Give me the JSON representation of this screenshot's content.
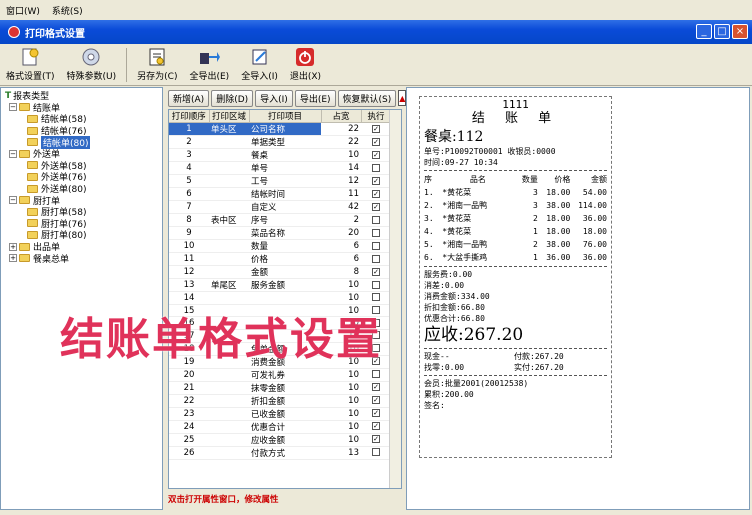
{
  "menu": {
    "items": [
      "窗口(W)",
      "系统(S)"
    ]
  },
  "window": {
    "title": "打印格式设置"
  },
  "toolbar": {
    "buttons": [
      {
        "label": "格式设置(T)",
        "icon": "gear-doc-icon"
      },
      {
        "label": "特殊参数(U)",
        "icon": "cd-icon"
      },
      {
        "label": "另存为(C)",
        "icon": "save-as-icon"
      },
      {
        "label": "全导出(E)",
        "icon": "export-icon"
      },
      {
        "label": "全导入(I)",
        "icon": "import-icon"
      },
      {
        "label": "退出(X)",
        "icon": "power-icon"
      }
    ]
  },
  "tree": {
    "root": "报表类型",
    "groups": [
      {
        "label": "结账单",
        "children": [
          "结帐单(58)",
          "结帐单(76)",
          "结帐单(80)"
        ]
      },
      {
        "label": "外送单",
        "children": [
          "外送单(58)",
          "外送单(76)",
          "外送单(80)"
        ]
      },
      {
        "label": "厨打单",
        "children": [
          "厨打单(58)",
          "厨打单(76)",
          "厨打单(80)"
        ]
      },
      {
        "label": "出品单",
        "children": []
      },
      {
        "label": "餐桌总单",
        "children": []
      }
    ],
    "selected": "结帐单(80)"
  },
  "actions": {
    "buttons": [
      "新增(A)",
      "删除(D)",
      "导入(I)",
      "导出(E)",
      "恢复默认(S)"
    ]
  },
  "grid": {
    "headers": [
      "打印顺序",
      "打印区域",
      "打印项目",
      "占宽",
      "执行"
    ],
    "rows": [
      {
        "no": "1",
        "region": "单头区",
        "item": "公司名称",
        "width": "22",
        "checked": true
      },
      {
        "no": "2",
        "region": "",
        "item": "单据类型",
        "width": "22",
        "checked": true
      },
      {
        "no": "3",
        "region": "",
        "item": "餐桌",
        "width": "10",
        "checked": true
      },
      {
        "no": "4",
        "region": "",
        "item": "单号",
        "width": "14",
        "checked": false
      },
      {
        "no": "5",
        "region": "",
        "item": "工号",
        "width": "12",
        "checked": true
      },
      {
        "no": "6",
        "region": "",
        "item": "结帐时间",
        "width": "11",
        "checked": true
      },
      {
        "no": "7",
        "region": "",
        "item": "自定义",
        "width": "42",
        "checked": true
      },
      {
        "no": "8",
        "region": "表中区",
        "item": "序号",
        "width": "2",
        "checked": false
      },
      {
        "no": "9",
        "region": "",
        "item": "菜品名称",
        "width": "20",
        "checked": false
      },
      {
        "no": "10",
        "region": "",
        "item": "数量",
        "width": "6",
        "checked": false
      },
      {
        "no": "11",
        "region": "",
        "item": "价格",
        "width": "6",
        "checked": false
      },
      {
        "no": "12",
        "region": "",
        "item": "金额",
        "width": "8",
        "checked": true
      },
      {
        "no": "13",
        "region": "单尾区",
        "item": "服务金额",
        "width": "10",
        "checked": false
      },
      {
        "no": "14",
        "region": "",
        "item": "",
        "width": "10",
        "checked": false
      },
      {
        "no": "15",
        "region": "",
        "item": "",
        "width": "10",
        "checked": false
      },
      {
        "no": "16",
        "region": "",
        "item": "",
        "width": "10",
        "checked": false
      },
      {
        "no": "17",
        "region": "",
        "item": "",
        "width": "10",
        "checked": false
      },
      {
        "no": "18",
        "region": "",
        "item": "免单金额",
        "width": "10",
        "checked": false
      },
      {
        "no": "19",
        "region": "",
        "item": "消费金额",
        "width": "10",
        "checked": true
      },
      {
        "no": "20",
        "region": "",
        "item": "可发礼券",
        "width": "10",
        "checked": false
      },
      {
        "no": "21",
        "region": "",
        "item": "抹零金额",
        "width": "10",
        "checked": true
      },
      {
        "no": "22",
        "region": "",
        "item": "折扣金额",
        "width": "10",
        "checked": true
      },
      {
        "no": "23",
        "region": "",
        "item": "已收金额",
        "width": "10",
        "checked": true
      },
      {
        "no": "24",
        "region": "",
        "item": "优惠合计",
        "width": "10",
        "checked": true
      },
      {
        "no": "25",
        "region": "",
        "item": "应收金额",
        "width": "10",
        "checked": true
      },
      {
        "no": "26",
        "region": "",
        "item": "付款方式",
        "width": "13",
        "checked": false
      }
    ]
  },
  "hint": "双击打开属性窗口，修改属性",
  "receipt": {
    "company": "1111",
    "title": "结 账 单",
    "table": "餐桌:112",
    "order_line": "单号:P10092T00001  收银员:0000",
    "time_line": "时间:09-27 10:34",
    "item_headers": [
      "序",
      "品名",
      "数量",
      "价格",
      "金额"
    ],
    "items": [
      [
        "1.",
        "*黄花菜",
        "3",
        "18.00",
        "54.00"
      ],
      [
        "2.",
        "*湘南一品鸭",
        "3",
        "38.00",
        "114.00"
      ],
      [
        "3.",
        "*黄花菜",
        "2",
        "18.00",
        "36.00"
      ],
      [
        "4.",
        "*黄花菜",
        "1",
        "18.00",
        "18.00"
      ],
      [
        "5.",
        "*湘南一品鸭",
        "2",
        "38.00",
        "76.00"
      ],
      [
        "6.",
        "*大盆手撕鸡",
        "1",
        "36.00",
        "36.00"
      ]
    ],
    "summary": [
      "服务费:0.00",
      "消差:0.00",
      "消费金额:334.00",
      "折扣金额:66.80",
      "优惠合计:66.80"
    ],
    "receivable": "应收:267.20",
    "pay_lines": [
      [
        "现金--",
        "付款:267.20"
      ],
      [
        "找零:0.00",
        "实付:267.20"
      ]
    ],
    "member": "会员:批量2001(20012538)",
    "points": "累积:200.00",
    "signature": "签名:"
  },
  "overlay_text": "结账单格式设置"
}
